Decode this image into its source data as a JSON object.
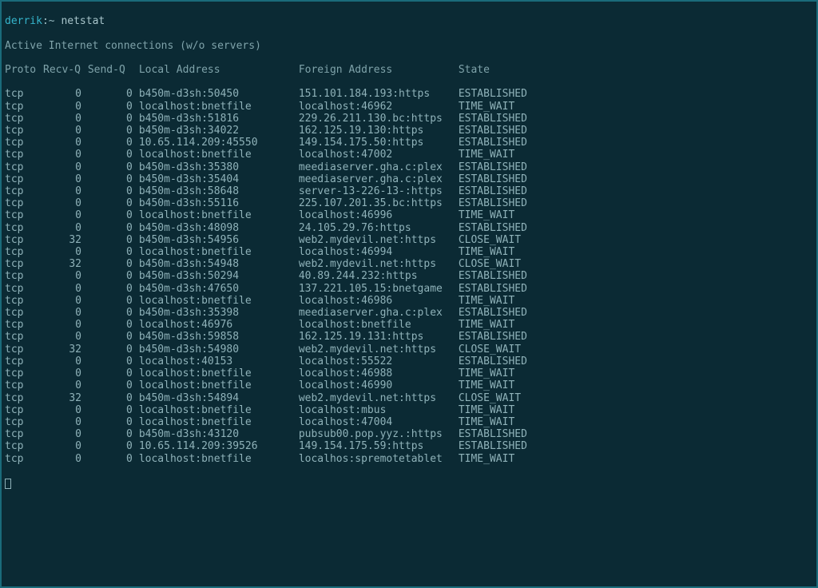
{
  "prompt": {
    "user": "derrik",
    "sep": ":",
    "cwd": "~",
    "command": "netstat"
  },
  "title_line": "Active Internet connections (w/o servers)",
  "headers": {
    "proto": "Proto",
    "recvq": "Recv-Q",
    "sendq": "Send-Q",
    "local": "Local Address",
    "foreign": "Foreign Address",
    "state": "State"
  },
  "rows": [
    {
      "proto": "tcp",
      "recvq": "0",
      "sendq": "0",
      "local": "b450m-d3sh:50450",
      "foreign": "151.101.184.193:https",
      "state": "ESTABLISHED"
    },
    {
      "proto": "tcp",
      "recvq": "0",
      "sendq": "0",
      "local": "localhost:bnetfile",
      "foreign": "localhost:46962",
      "state": "TIME_WAIT"
    },
    {
      "proto": "tcp",
      "recvq": "0",
      "sendq": "0",
      "local": "b450m-d3sh:51816",
      "foreign": "229.26.211.130.bc:https",
      "state": "ESTABLISHED"
    },
    {
      "proto": "tcp",
      "recvq": "0",
      "sendq": "0",
      "local": "b450m-d3sh:34022",
      "foreign": "162.125.19.130:https",
      "state": "ESTABLISHED"
    },
    {
      "proto": "tcp",
      "recvq": "0",
      "sendq": "0",
      "local": "10.65.114.209:45550",
      "foreign": "149.154.175.50:https",
      "state": "ESTABLISHED"
    },
    {
      "proto": "tcp",
      "recvq": "0",
      "sendq": "0",
      "local": "localhost:bnetfile",
      "foreign": "localhost:47002",
      "state": "TIME_WAIT"
    },
    {
      "proto": "tcp",
      "recvq": "0",
      "sendq": "0",
      "local": "b450m-d3sh:35380",
      "foreign": "meediaserver.gha.c:plex",
      "state": "ESTABLISHED"
    },
    {
      "proto": "tcp",
      "recvq": "0",
      "sendq": "0",
      "local": "b450m-d3sh:35404",
      "foreign": "meediaserver.gha.c:plex",
      "state": "ESTABLISHED"
    },
    {
      "proto": "tcp",
      "recvq": "0",
      "sendq": "0",
      "local": "b450m-d3sh:58648",
      "foreign": "server-13-226-13-:https",
      "state": "ESTABLISHED"
    },
    {
      "proto": "tcp",
      "recvq": "0",
      "sendq": "0",
      "local": "b450m-d3sh:55116",
      "foreign": "225.107.201.35.bc:https",
      "state": "ESTABLISHED"
    },
    {
      "proto": "tcp",
      "recvq": "0",
      "sendq": "0",
      "local": "localhost:bnetfile",
      "foreign": "localhost:46996",
      "state": "TIME_WAIT"
    },
    {
      "proto": "tcp",
      "recvq": "0",
      "sendq": "0",
      "local": "b450m-d3sh:48098",
      "foreign": "24.105.29.76:https",
      "state": "ESTABLISHED"
    },
    {
      "proto": "tcp",
      "recvq": "32",
      "sendq": "0",
      "local": "b450m-d3sh:54956",
      "foreign": "web2.mydevil.net:https",
      "state": "CLOSE_WAIT"
    },
    {
      "proto": "tcp",
      "recvq": "0",
      "sendq": "0",
      "local": "localhost:bnetfile",
      "foreign": "localhost:46994",
      "state": "TIME_WAIT"
    },
    {
      "proto": "tcp",
      "recvq": "32",
      "sendq": "0",
      "local": "b450m-d3sh:54948",
      "foreign": "web2.mydevil.net:https",
      "state": "CLOSE_WAIT"
    },
    {
      "proto": "tcp",
      "recvq": "0",
      "sendq": "0",
      "local": "b450m-d3sh:50294",
      "foreign": "40.89.244.232:https",
      "state": "ESTABLISHED"
    },
    {
      "proto": "tcp",
      "recvq": "0",
      "sendq": "0",
      "local": "b450m-d3sh:47650",
      "foreign": "137.221.105.15:bnetgame",
      "state": "ESTABLISHED"
    },
    {
      "proto": "tcp",
      "recvq": "0",
      "sendq": "0",
      "local": "localhost:bnetfile",
      "foreign": "localhost:46986",
      "state": "TIME_WAIT"
    },
    {
      "proto": "tcp",
      "recvq": "0",
      "sendq": "0",
      "local": "b450m-d3sh:35398",
      "foreign": "meediaserver.gha.c:plex",
      "state": "ESTABLISHED"
    },
    {
      "proto": "tcp",
      "recvq": "0",
      "sendq": "0",
      "local": "localhost:46976",
      "foreign": "localhost:bnetfile",
      "state": "TIME_WAIT"
    },
    {
      "proto": "tcp",
      "recvq": "0",
      "sendq": "0",
      "local": "b450m-d3sh:59858",
      "foreign": "162.125.19.131:https",
      "state": "ESTABLISHED"
    },
    {
      "proto": "tcp",
      "recvq": "32",
      "sendq": "0",
      "local": "b450m-d3sh:54980",
      "foreign": "web2.mydevil.net:https",
      "state": "CLOSE_WAIT"
    },
    {
      "proto": "tcp",
      "recvq": "0",
      "sendq": "0",
      "local": "localhost:40153",
      "foreign": "localhost:55522",
      "state": "ESTABLISHED"
    },
    {
      "proto": "tcp",
      "recvq": "0",
      "sendq": "0",
      "local": "localhost:bnetfile",
      "foreign": "localhost:46988",
      "state": "TIME_WAIT"
    },
    {
      "proto": "tcp",
      "recvq": "0",
      "sendq": "0",
      "local": "localhost:bnetfile",
      "foreign": "localhost:46990",
      "state": "TIME_WAIT"
    },
    {
      "proto": "tcp",
      "recvq": "32",
      "sendq": "0",
      "local": "b450m-d3sh:54894",
      "foreign": "web2.mydevil.net:https",
      "state": "CLOSE_WAIT"
    },
    {
      "proto": "tcp",
      "recvq": "0",
      "sendq": "0",
      "local": "localhost:bnetfile",
      "foreign": "localhost:mbus",
      "state": "TIME_WAIT"
    },
    {
      "proto": "tcp",
      "recvq": "0",
      "sendq": "0",
      "local": "localhost:bnetfile",
      "foreign": "localhost:47004",
      "state": "TIME_WAIT"
    },
    {
      "proto": "tcp",
      "recvq": "0",
      "sendq": "0",
      "local": "b450m-d3sh:43120",
      "foreign": "pubsub00.pop.yyz.:https",
      "state": "ESTABLISHED"
    },
    {
      "proto": "tcp",
      "recvq": "0",
      "sendq": "0",
      "local": "10.65.114.209:39526",
      "foreign": "149.154.175.59:https",
      "state": "ESTABLISHED"
    },
    {
      "proto": "tcp",
      "recvq": "0",
      "sendq": "0",
      "local": "localhost:bnetfile",
      "foreign": "localhos:spremotetablet",
      "state": "TIME_WAIT"
    }
  ]
}
